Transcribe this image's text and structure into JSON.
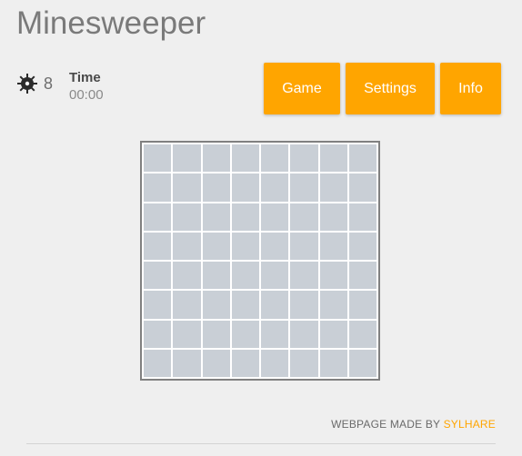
{
  "app": {
    "title": "Minesweeper"
  },
  "status": {
    "mine_icon": "mine-icon",
    "mine_count": "8",
    "time_label": "Time",
    "time_value": "00:00"
  },
  "menu": {
    "game_label": "Game",
    "settings_label": "Settings",
    "info_label": "Info"
  },
  "board": {
    "rows": 8,
    "cols": 8,
    "cell_state": "covered"
  },
  "footer": {
    "prefix": "WEBPAGE MADE BY ",
    "author": "SYLHARE"
  },
  "colors": {
    "accent": "#ffa500",
    "cell": "#c9cfd6",
    "background": "#efefef"
  }
}
